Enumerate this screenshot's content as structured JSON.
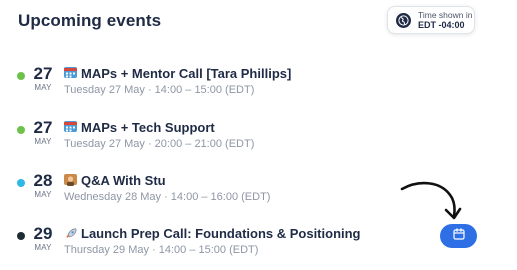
{
  "header": {
    "title": "Upcoming events",
    "timezone": {
      "line1": "Time shown in",
      "line2": "EDT -04:00",
      "icon": "globe-icon"
    }
  },
  "events": [
    {
      "day": "27",
      "month": "MAY",
      "title": "MAPs + Mentor Call [Tara Phillips]",
      "emoji": "calendar-emoji",
      "subtitle": "Tuesday 27 May · 14:00 – 15:00 (EDT)",
      "dot_color": "#6cc24a"
    },
    {
      "day": "27",
      "month": "MAY",
      "title": "MAPs + Tech Support",
      "emoji": "calendar-emoji",
      "subtitle": "Tuesday 27 May · 20:00 – 21:00 (EDT)",
      "dot_color": "#6cc24a"
    },
    {
      "day": "28",
      "month": "MAY",
      "title": "Q&A With Stu",
      "emoji": "person-emoji",
      "subtitle": "Wednesday 28 May · 14:00 – 16:00 (EDT)",
      "dot_color": "#2fb7e6"
    },
    {
      "day": "29",
      "month": "MAY",
      "title": "Launch Prep Call: Foundations & Positioning",
      "emoji": "rocket-emoji",
      "subtitle": "Thursday 29 May · 14:00 – 15:00 (EDT)",
      "dot_color": "#1f2b33"
    }
  ],
  "calendar_button": {
    "icon": "calendar-icon",
    "color": "#2f6fe6"
  }
}
